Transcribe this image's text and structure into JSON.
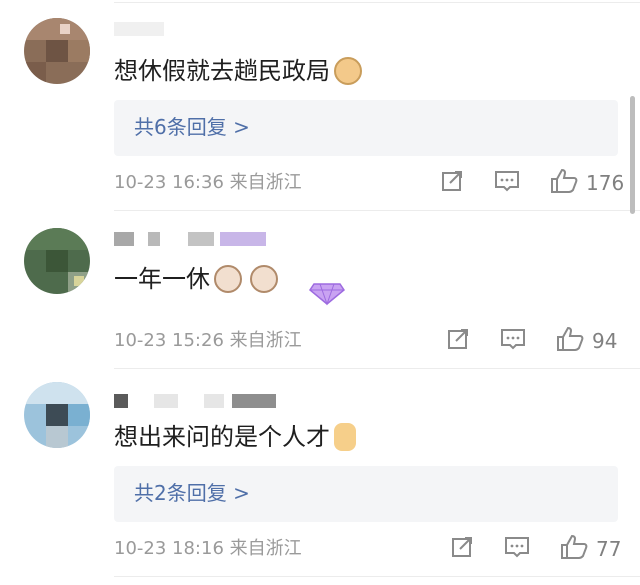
{
  "comments": [
    {
      "text": "想休假就去趟民政局",
      "emoji": "doge-emoji",
      "replies_label": "共6条回复 >",
      "timestamp": "10-23 16:36",
      "location": "来自浙江",
      "likes": "176"
    },
    {
      "text": "一年一休",
      "emoji": "cat-emoji",
      "timestamp": "10-23 15:26",
      "location": "来自浙江",
      "likes": "94"
    },
    {
      "text": "想出来问的是个人才",
      "emoji": "thumbs-up-emoji",
      "replies_label": "共2条回复 >",
      "timestamp": "10-23 18:16",
      "location": "来自浙江",
      "likes": "77"
    }
  ],
  "icons": {
    "share": "share-icon",
    "comment": "comment-icon",
    "like": "thumbs-up-icon"
  },
  "colors": {
    "reply_link": "#4f6fa8",
    "meta_text": "#9a9a9a",
    "reply_bg": "#f4f5f7"
  }
}
